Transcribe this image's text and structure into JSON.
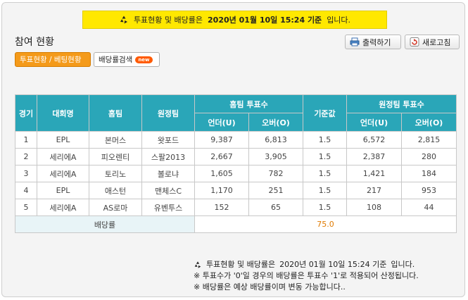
{
  "notice": {
    "prefix": "투표현황 및 배당률은",
    "date": "2020년 01월 10일 15:24 기준",
    "suffix": "입니다."
  },
  "title": "참여 현황",
  "buttons": {
    "print": "출력하기",
    "refresh": "새로고침"
  },
  "tabs": {
    "active": "투표현황 / 베팅현황",
    "other": "배당률검색",
    "badge": "new"
  },
  "table": {
    "headers": {
      "game": "경기",
      "league": "대회명",
      "home": "홈팀",
      "away": "원정팀",
      "home_votes": "홈팀 투표수",
      "base": "기준값",
      "away_votes": "원정팀 투표수",
      "under": "언더(U)",
      "over": "오버(O)"
    },
    "rows": [
      {
        "no": "1",
        "league": "EPL",
        "home": "본머스",
        "away": "왓포드",
        "hu": "9,387",
        "ho": "6,813",
        "base": "1.5",
        "au": "6,572",
        "ao": "2,815"
      },
      {
        "no": "2",
        "league": "세리에A",
        "home": "피오렌티",
        "away": "스팔2013",
        "hu": "2,667",
        "ho": "3,905",
        "base": "1.5",
        "au": "2,387",
        "ao": "280"
      },
      {
        "no": "3",
        "league": "세리에A",
        "home": "토리노",
        "away": "볼로냐",
        "hu": "1,605",
        "ho": "782",
        "base": "1.5",
        "au": "1,421",
        "ao": "184"
      },
      {
        "no": "4",
        "league": "EPL",
        "home": "애스턴",
        "away": "맨체스C",
        "hu": "1,170",
        "ho": "251",
        "base": "1.5",
        "au": "217",
        "ao": "953"
      },
      {
        "no": "5",
        "league": "세리에A",
        "home": "AS로마",
        "away": "유벤투스",
        "hu": "152",
        "ho": "65",
        "base": "1.5",
        "au": "108",
        "ao": "44"
      }
    ],
    "bet_label": "배당률",
    "bet_value": "75.0"
  },
  "footer": {
    "line1_prefix": "투표현황 및 배당률은",
    "line1_date": "2020년 01월 10일 15:24 기준",
    "line1_suffix": "입니다.",
    "line2": "※ 투표수가 '0'일 경우의 배당률은 투표수 '1'로 적용되어 산정됩니다.",
    "line3": "※ 배당률은 예상 배당률이며 변동 가능합니다.."
  },
  "colors": {
    "header_teal": "#2aa6b8",
    "notice_yellow": "#ffe800",
    "tab_orange": "#f49a1a",
    "bet_value": "#e07a00"
  }
}
